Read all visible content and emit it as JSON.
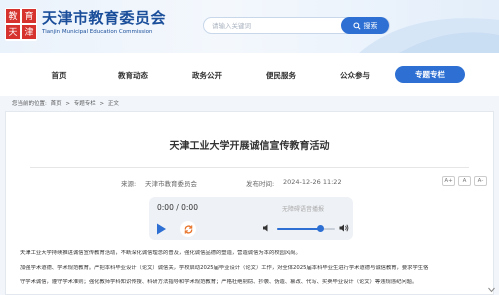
{
  "header": {
    "logo_text": "教育天津",
    "title": "天津市教育委员会",
    "subtitle": "Tianjin Municipal Education Commission",
    "search": {
      "placeholder": "请输入关键词",
      "button_label": "搜索"
    }
  },
  "nav": {
    "items": [
      {
        "label": "首页"
      },
      {
        "label": "教育动态"
      },
      {
        "label": "政务公开"
      },
      {
        "label": "便民服务"
      },
      {
        "label": "公众参与"
      },
      {
        "label": "专题专栏"
      }
    ],
    "active_index": 5
  },
  "breadcrumb": {
    "prefix": "您当前的位置:",
    "items": [
      "首页",
      "专题专栏",
      "正文"
    ],
    "separator": ">"
  },
  "article": {
    "title": "天津工业大学开展诚信宣传教育活动",
    "source_label": "来源:",
    "source": "天津市教育委员会",
    "date_label": "发布时间:",
    "date": "2024-12-26 11:22",
    "font_controls": [
      "A+",
      "A",
      "A-"
    ],
    "paragraphs": [
      "天津工业大学持续推进诚信宣传教育活动，不断深化诚信理念的普及，强化诚信品德的塑造，营造诚信为本的校园风尚。",
      "加强学术道德、学术规范教育。严把本科毕业设计（论文）诚信关，学校启动2025届毕业设计（论文）工作，对全体2025届本科毕业生进行学术道德与诚信教育，要求学生恪",
      "守学术诚信，遵守学术准则；强化教师学科知识传授、科研方法指导和学术规范教育；严格杜绝剽窃、抄袭、伪造、篡改、代写、买卖毕业设计（论文）等违规违纪问题。"
    ]
  },
  "player": {
    "time": "0:00 / 0:00",
    "note": "无障碍语音播报",
    "volume": 0.75
  },
  "colors": {
    "accent": "#2d6fd3",
    "brand_red": "#d6322e",
    "title_blue": "#1a4e9a"
  }
}
